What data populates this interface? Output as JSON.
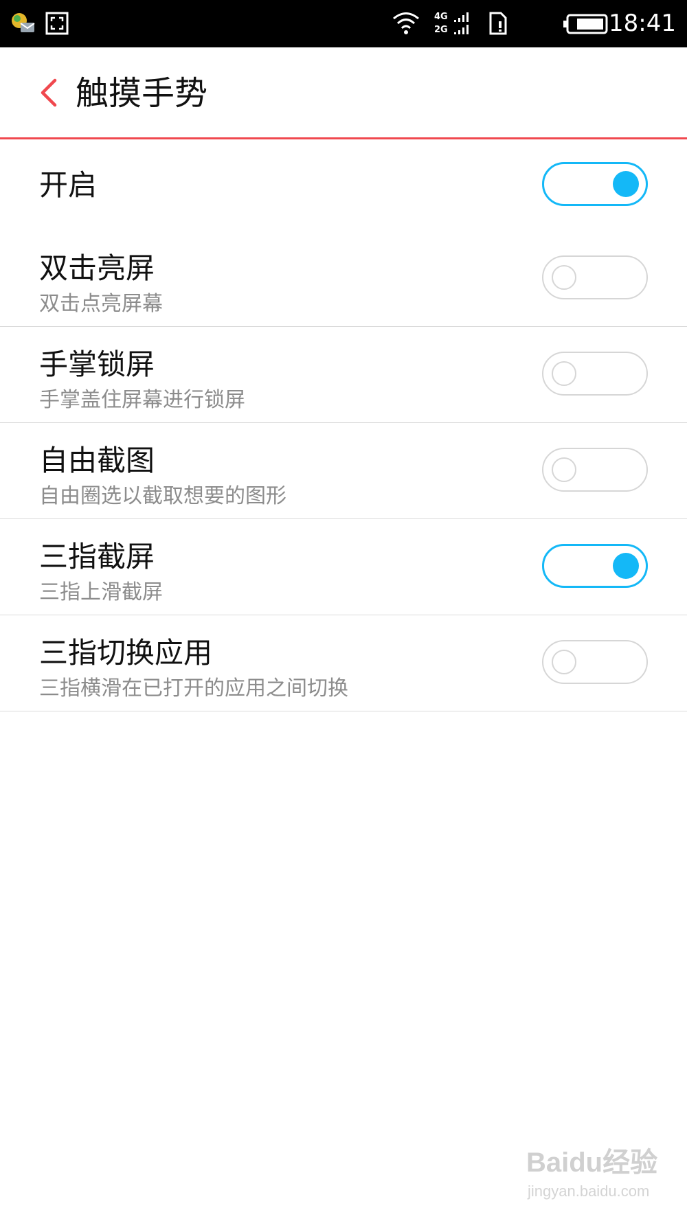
{
  "status_bar": {
    "time": "18:41",
    "network_labels": [
      "4G",
      "2G"
    ],
    "icons": [
      "notification-app-icon",
      "screenshot-icon",
      "wifi-icon",
      "cellular-signal-icon",
      "sim-card-icon",
      "battery-icon"
    ]
  },
  "app_bar": {
    "title": "触摸手势",
    "back_icon": "chevron-left-icon",
    "accent_color": "#f0484e"
  },
  "master_switch": {
    "label": "开启",
    "on": true
  },
  "gestures": [
    {
      "title": "双击亮屏",
      "subtitle": "双击点亮屏幕",
      "on": false
    },
    {
      "title": "手掌锁屏",
      "subtitle": "手掌盖住屏幕进行锁屏",
      "on": false
    },
    {
      "title": "自由截图",
      "subtitle": "自由圈选以截取想要的图形",
      "on": false
    },
    {
      "title": "三指截屏",
      "subtitle": "三指上滑截屏",
      "on": true
    },
    {
      "title": "三指切换应用",
      "subtitle": "三指横滑在已打开的应用之间切换",
      "on": false
    }
  ],
  "toggle_on_color": "#14b8f7",
  "watermark": {
    "main": "Baidu经验",
    "sub": "jingyan.baidu.com"
  }
}
